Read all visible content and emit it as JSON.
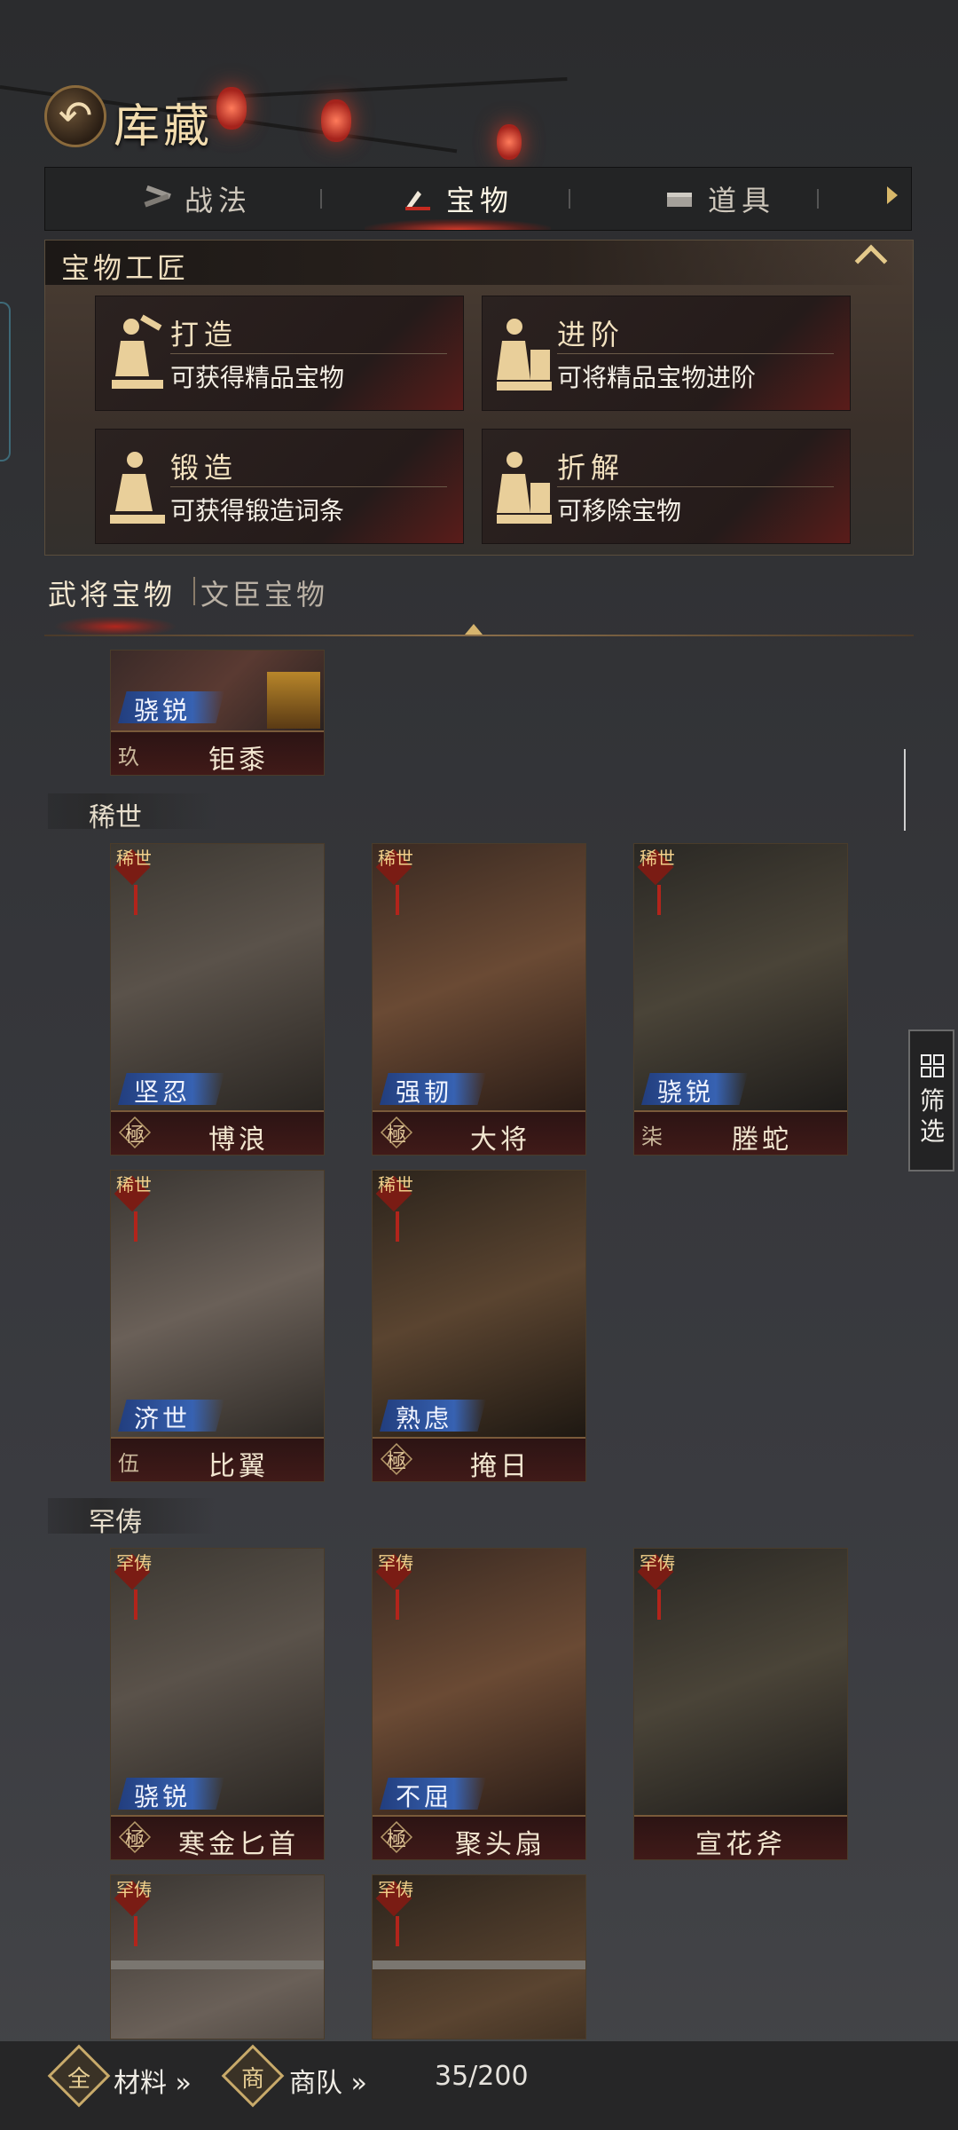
{
  "header": {
    "back_icon": "back-arrow-icon",
    "title": "库藏"
  },
  "tabs": [
    {
      "label": "战法",
      "icon": "tactics-icon",
      "active": false
    },
    {
      "label": "宝物",
      "icon": "treasure-icon",
      "active": true
    },
    {
      "label": "道具",
      "icon": "items-icon",
      "active": false
    }
  ],
  "artisan": {
    "title": "宝物工匠",
    "cards": [
      {
        "name": "打造",
        "desc": "可获得精品宝物"
      },
      {
        "name": "进阶",
        "desc": "可将精品宝物进阶"
      },
      {
        "name": "锻造",
        "desc": "可获得锻造词条"
      },
      {
        "name": "折解",
        "desc": "可移除宝物"
      }
    ]
  },
  "categories": {
    "general": "武将宝物",
    "civil": "文臣宝物"
  },
  "top_item": {
    "tag": "骁锐",
    "grade": "玖",
    "name": "钜黍"
  },
  "sections": [
    {
      "title": "稀世",
      "seal": "稀世",
      "items": [
        {
          "tag": "坚忍",
          "grade": "極",
          "name": "博浪"
        },
        {
          "tag": "强韧",
          "grade": "極",
          "name": "大将"
        },
        {
          "tag": "骁锐",
          "grade": "柒",
          "name": "塍蛇"
        },
        {
          "tag": "济世",
          "grade": "伍",
          "name": "比翼"
        },
        {
          "tag": "熟虑",
          "grade": "極",
          "name": "掩日"
        }
      ]
    },
    {
      "title": "罕俦",
      "seal": "罕俦",
      "items": [
        {
          "tag": "骁锐",
          "grade": "極",
          "name": "寒金匕首"
        },
        {
          "tag": "不屈",
          "grade": "極",
          "name": "聚头扇"
        },
        {
          "tag": "",
          "grade": "",
          "name": "宣花斧"
        },
        {
          "tag": "",
          "grade": "",
          "name": ""
        },
        {
          "tag": "",
          "grade": "",
          "name": ""
        }
      ]
    }
  ],
  "filter": {
    "label": "筛选",
    "icon": "grid-icon"
  },
  "bottom": {
    "materials": {
      "icon_char": "全",
      "label": "材料 »"
    },
    "caravan": {
      "icon_char": "商",
      "label": "商队 »"
    },
    "capacity": "35/200"
  },
  "colors": {
    "accent_red": "#b2261d",
    "gold": "#d8b86a",
    "tag_blue": "#3762b2"
  }
}
